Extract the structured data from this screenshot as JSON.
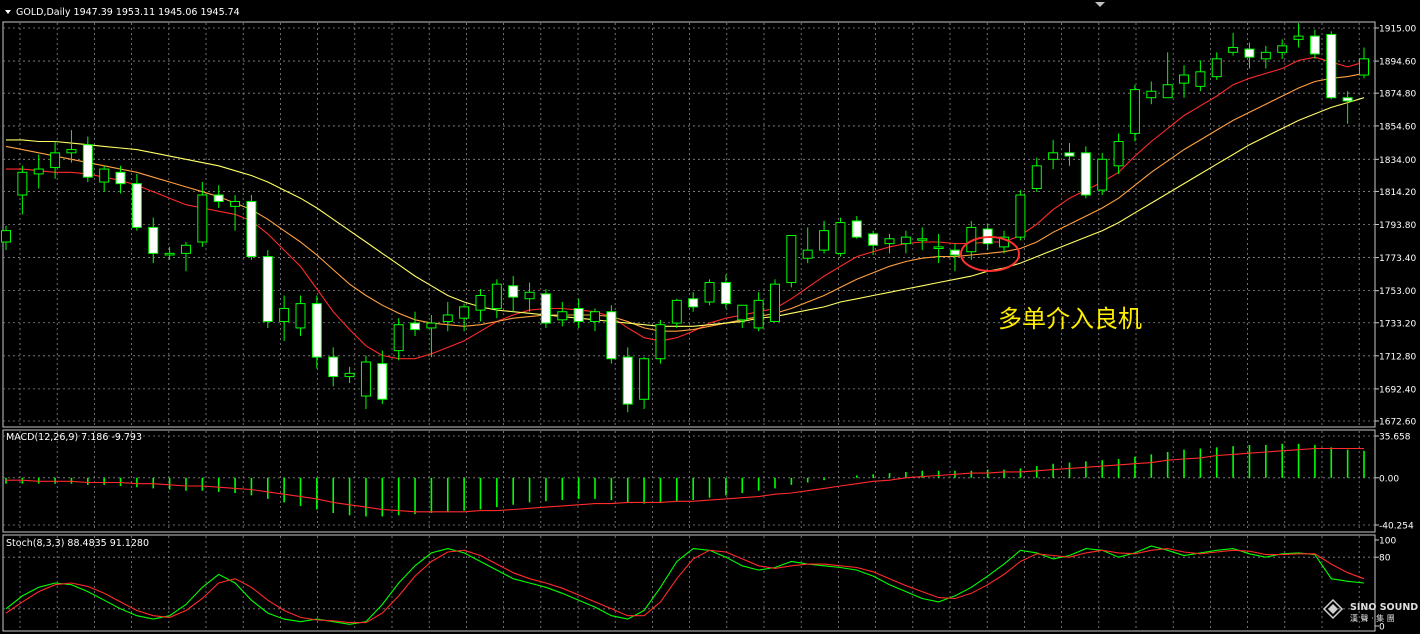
{
  "price_pane": {
    "header": "GOLD,Daily  1947.39 1953.11 1945.06 1945.74",
    "annotation": "多单介入良机",
    "y_ticks": [
      "1915.00",
      "1894.60",
      "1874.80",
      "1854.60",
      "1834.00",
      "1814.20",
      "1793.80",
      "1773.40",
      "1753.00",
      "1733.20",
      "1712.80",
      "1692.40",
      "1672.60"
    ]
  },
  "macd_pane": {
    "header": "MACD(12,26,9) 7.186 -9.793",
    "y_ticks": [
      "35.658",
      "0.00",
      "-40.254"
    ]
  },
  "stoch_pane": {
    "header": "Stoch(8,3,3) 88.4835 91.1280",
    "y_ticks": [
      "100",
      "80",
      "0"
    ]
  },
  "watermark": {
    "line1": "SINO SOUND",
    "line2": "漢 聲 · 集 團"
  },
  "colors": {
    "background": "#000000",
    "grid": "#8a8a8a",
    "bull_candle": "#000000",
    "bear_candle": "#ffffff",
    "wick": "#00ff00",
    "ma_fast": "#ff2a2a",
    "ma_mid": "#ffa040",
    "ma_slow": "#ffff66",
    "macd_hist": "#00ff00",
    "macd_signal": "#ff2a2a",
    "annotation": "#ffee00",
    "circle": "#ff3030"
  },
  "chart_data": [
    {
      "type": "candlestick",
      "symbol": "GOLD",
      "timeframe": "Daily",
      "ylim": [
        1672.6,
        1915.0
      ],
      "candles": [
        [
          1783,
          1793,
          1778,
          1790
        ],
        [
          1812,
          1830,
          1800,
          1826
        ],
        [
          1825,
          1837,
          1816,
          1828
        ],
        [
          1829,
          1845,
          1822,
          1838
        ],
        [
          1838,
          1852,
          1832,
          1840
        ],
        [
          1843,
          1848,
          1820,
          1823
        ],
        [
          1820,
          1830,
          1814,
          1828
        ],
        [
          1826,
          1830,
          1813,
          1819
        ],
        [
          1819,
          1825,
          1790,
          1792
        ],
        [
          1792,
          1798,
          1770,
          1776
        ],
        [
          1775,
          1780,
          1772,
          1776
        ],
        [
          1776,
          1783,
          1765,
          1781
        ],
        [
          1783,
          1820,
          1780,
          1812
        ],
        [
          1812,
          1818,
          1804,
          1808
        ],
        [
          1805,
          1812,
          1790,
          1808
        ],
        [
          1808,
          1812,
          1772,
          1774
        ],
        [
          1774,
          1778,
          1730,
          1734
        ],
        [
          1734,
          1750,
          1722,
          1742
        ],
        [
          1730,
          1750,
          1725,
          1745
        ],
        [
          1745,
          1750,
          1705,
          1712
        ],
        [
          1712,
          1718,
          1694,
          1700
        ],
        [
          1700,
          1706,
          1696,
          1702
        ],
        [
          1688,
          1713,
          1680,
          1709
        ],
        [
          1708,
          1716,
          1683,
          1686
        ],
        [
          1716,
          1736,
          1710,
          1732
        ],
        [
          1733,
          1740,
          1725,
          1729
        ],
        [
          1730,
          1738,
          1712,
          1733
        ],
        [
          1734,
          1746,
          1728,
          1738
        ],
        [
          1736,
          1745,
          1728,
          1743
        ],
        [
          1741,
          1754,
          1734,
          1750
        ],
        [
          1742,
          1760,
          1736,
          1757
        ],
        [
          1756,
          1762,
          1740,
          1749
        ],
        [
          1748,
          1758,
          1740,
          1752
        ],
        [
          1751,
          1754,
          1730,
          1733
        ],
        [
          1735,
          1746,
          1731,
          1740
        ],
        [
          1742,
          1748,
          1730,
          1734
        ],
        [
          1734,
          1742,
          1728,
          1740
        ],
        [
          1740,
          1744,
          1708,
          1711
        ],
        [
          1712,
          1718,
          1678,
          1683
        ],
        [
          1686,
          1712,
          1680,
          1711
        ],
        [
          1711,
          1735,
          1708,
          1732
        ],
        [
          1733,
          1748,
          1730,
          1747
        ],
        [
          1748,
          1752,
          1740,
          1743
        ],
        [
          1746,
          1760,
          1744,
          1758
        ],
        [
          1758,
          1763,
          1742,
          1745
        ],
        [
          1735,
          1742,
          1730,
          1744
        ],
        [
          1730,
          1752,
          1728,
          1747
        ],
        [
          1734,
          1760,
          1734,
          1757
        ],
        [
          1758,
          1783,
          1755,
          1787
        ],
        [
          1773,
          1792,
          1770,
          1778
        ],
        [
          1778,
          1796,
          1776,
          1790
        ],
        [
          1776,
          1798,
          1774,
          1795
        ],
        [
          1796,
          1799,
          1785,
          1786
        ],
        [
          1788,
          1790,
          1775,
          1781
        ],
        [
          1782,
          1788,
          1776,
          1785
        ],
        [
          1782,
          1790,
          1776,
          1786
        ],
        [
          1785,
          1792,
          1778,
          1785
        ],
        [
          1779,
          1788,
          1770,
          1780
        ],
        [
          1778,
          1782,
          1765,
          1775
        ],
        [
          1777,
          1796,
          1772,
          1792
        ],
        [
          1791,
          1794,
          1778,
          1782
        ],
        [
          1780,
          1790,
          1776,
          1786
        ],
        [
          1786,
          1815,
          1784,
          1812
        ],
        [
          1816,
          1835,
          1814,
          1830
        ],
        [
          1834,
          1846,
          1828,
          1838
        ],
        [
          1838,
          1844,
          1830,
          1836
        ],
        [
          1838,
          1842,
          1810,
          1812
        ],
        [
          1815,
          1838,
          1812,
          1834
        ],
        [
          1830,
          1850,
          1825,
          1845
        ],
        [
          1850,
          1880,
          1845,
          1877
        ],
        [
          1872,
          1882,
          1868,
          1876
        ],
        [
          1872,
          1900,
          1872,
          1880
        ],
        [
          1881,
          1892,
          1872,
          1886
        ],
        [
          1879,
          1895,
          1876,
          1888
        ],
        [
          1885,
          1900,
          1883,
          1896
        ],
        [
          1900,
          1912,
          1898,
          1903
        ],
        [
          1902,
          1906,
          1890,
          1897
        ],
        [
          1896,
          1904,
          1890,
          1900
        ],
        [
          1900,
          1908,
          1896,
          1904
        ],
        [
          1908,
          1918,
          1903,
          1910
        ],
        [
          1910,
          1914,
          1896,
          1899
        ],
        [
          1911,
          1913,
          1871,
          1872
        ],
        [
          1872,
          1876,
          1856,
          1870
        ],
        [
          1886,
          1903,
          1884,
          1896
        ]
      ],
      "moving_averages": [
        {
          "color": "#ff2a2a",
          "values": [
            1828,
            1828,
            1827,
            1826,
            1826,
            1825,
            1823,
            1821,
            1818,
            1814,
            1810,
            1806,
            1804,
            1802,
            1800,
            1796,
            1788,
            1778,
            1768,
            1754,
            1740,
            1729,
            1719,
            1713,
            1711,
            1711,
            1714,
            1718,
            1722,
            1728,
            1734,
            1738,
            1741,
            1742,
            1742,
            1741,
            1740,
            1737,
            1730,
            1724,
            1722,
            1724,
            1728,
            1733,
            1736,
            1738,
            1740,
            1742,
            1748,
            1755,
            1762,
            1768,
            1774,
            1777,
            1780,
            1782,
            1783,
            1783,
            1782,
            1782,
            1783,
            1783,
            1787,
            1794,
            1803,
            1810,
            1815,
            1820,
            1826,
            1836,
            1845,
            1853,
            1861,
            1867,
            1873,
            1880,
            1884,
            1887,
            1890,
            1895,
            1897,
            1894,
            1891,
            1894
          ]
        },
        {
          "color": "#ffa040",
          "values": [
            1842,
            1840,
            1838,
            1836,
            1834,
            1832,
            1830,
            1828,
            1826,
            1823,
            1820,
            1817,
            1814,
            1811,
            1807,
            1803,
            1797,
            1790,
            1783,
            1775,
            1766,
            1757,
            1750,
            1744,
            1739,
            1735,
            1733,
            1732,
            1731,
            1732,
            1734,
            1736,
            1737,
            1738,
            1738,
            1738,
            1738,
            1737,
            1734,
            1730,
            1728,
            1728,
            1729,
            1731,
            1733,
            1735,
            1737,
            1739,
            1742,
            1746,
            1750,
            1755,
            1760,
            1764,
            1768,
            1771,
            1773,
            1774,
            1774,
            1775,
            1776,
            1777,
            1779,
            1783,
            1789,
            1794,
            1799,
            1804,
            1810,
            1818,
            1826,
            1833,
            1840,
            1846,
            1852,
            1858,
            1863,
            1868,
            1873,
            1878,
            1882,
            1884,
            1885,
            1887
          ]
        },
        {
          "color": "#ffff66",
          "values": [
            1846,
            1846,
            1845,
            1845,
            1844,
            1843,
            1842,
            1841,
            1840,
            1838,
            1836,
            1834,
            1832,
            1830,
            1827,
            1824,
            1820,
            1815,
            1810,
            1804,
            1797,
            1790,
            1783,
            1776,
            1769,
            1762,
            1756,
            1750,
            1746,
            1743,
            1741,
            1740,
            1739,
            1738,
            1737,
            1736,
            1735,
            1734,
            1733,
            1732,
            1731,
            1731,
            1731,
            1732,
            1733,
            1734,
            1736,
            1737,
            1739,
            1741,
            1743,
            1746,
            1748,
            1750,
            1752,
            1754,
            1756,
            1758,
            1760,
            1762,
            1765,
            1767,
            1770,
            1774,
            1778,
            1782,
            1786,
            1790,
            1795,
            1801,
            1807,
            1813,
            1819,
            1825,
            1831,
            1837,
            1843,
            1848,
            1853,
            1858,
            1862,
            1866,
            1869,
            1872
          ]
        }
      ]
    },
    {
      "type": "bar+line",
      "name": "MACD(12,26,9)",
      "ylim": [
        -40.254,
        35.658
      ],
      "histogram": [
        -5,
        -5,
        -5,
        -5,
        -5,
        -6,
        -6,
        -7,
        -8,
        -9,
        -10,
        -11,
        -11,
        -12,
        -13,
        -15,
        -18,
        -21,
        -24,
        -27,
        -30,
        -32,
        -33,
        -33,
        -32,
        -31,
        -30,
        -29,
        -28,
        -27,
        -25,
        -23,
        -21,
        -20,
        -19,
        -18,
        -18,
        -19,
        -21,
        -22,
        -21,
        -20,
        -19,
        -17,
        -15,
        -13,
        -11,
        -9,
        -6,
        -4,
        -2,
        0,
        2,
        3,
        4,
        5,
        6,
        6,
        6,
        6,
        7,
        7,
        8,
        10,
        12,
        13,
        14,
        15,
        16,
        18,
        20,
        22,
        24,
        25,
        26,
        27,
        28,
        28,
        29,
        29,
        28,
        26,
        24,
        23
      ],
      "signal": [
        -2,
        -2,
        -3,
        -3,
        -3,
        -4,
        -4,
        -4,
        -5,
        -5,
        -6,
        -7,
        -7,
        -8,
        -9,
        -10,
        -12,
        -14,
        -16,
        -18,
        -21,
        -23,
        -25,
        -27,
        -28,
        -29,
        -29,
        -29,
        -29,
        -28,
        -28,
        -27,
        -26,
        -25,
        -24,
        -23,
        -22,
        -22,
        -21,
        -21,
        -21,
        -20,
        -20,
        -19,
        -18,
        -17,
        -16,
        -14,
        -13,
        -11,
        -9,
        -7,
        -5,
        -3,
        -2,
        0,
        1,
        2,
        3,
        4,
        4,
        5,
        5,
        6,
        7,
        8,
        9,
        10,
        11,
        12,
        13,
        15,
        16,
        17,
        19,
        20,
        21,
        22,
        23,
        24,
        25,
        25,
        25,
        25
      ]
    },
    {
      "type": "line",
      "name": "Stoch(8,3,3)",
      "ylim": [
        0,
        100
      ],
      "series": [
        {
          "color": "#00ff00",
          "values": [
            20,
            35,
            45,
            50,
            48,
            40,
            30,
            20,
            12,
            8,
            12,
            25,
            45,
            60,
            50,
            30,
            15,
            8,
            5,
            8,
            5,
            2,
            5,
            25,
            50,
            70,
            85,
            90,
            85,
            75,
            65,
            55,
            50,
            45,
            38,
            30,
            22,
            12,
            8,
            18,
            45,
            75,
            90,
            88,
            80,
            70,
            65,
            68,
            75,
            72,
            70,
            68,
            65,
            58,
            48,
            40,
            32,
            28,
            35,
            45,
            58,
            72,
            88,
            85,
            78,
            82,
            90,
            88,
            80,
            85,
            93,
            88,
            82,
            85,
            88,
            90,
            84,
            80,
            84,
            85,
            83,
            55,
            52,
            50
          ]
        },
        {
          "color": "#ff2a2a",
          "values": [
            15,
            28,
            40,
            48,
            50,
            46,
            38,
            28,
            18,
            12,
            10,
            18,
            32,
            50,
            55,
            45,
            30,
            18,
            10,
            7,
            6,
            4,
            4,
            15,
            35,
            58,
            75,
            86,
            88,
            82,
            72,
            62,
            55,
            50,
            44,
            36,
            28,
            20,
            12,
            12,
            28,
            55,
            78,
            88,
            86,
            78,
            70,
            67,
            70,
            72,
            72,
            70,
            68,
            63,
            55,
            47,
            40,
            33,
            32,
            38,
            48,
            60,
            75,
            84,
            82,
            80,
            85,
            88,
            85,
            84,
            88,
            90,
            86,
            84,
            86,
            88,
            87,
            83,
            83,
            84,
            84,
            72,
            62,
            55
          ]
        }
      ]
    }
  ]
}
